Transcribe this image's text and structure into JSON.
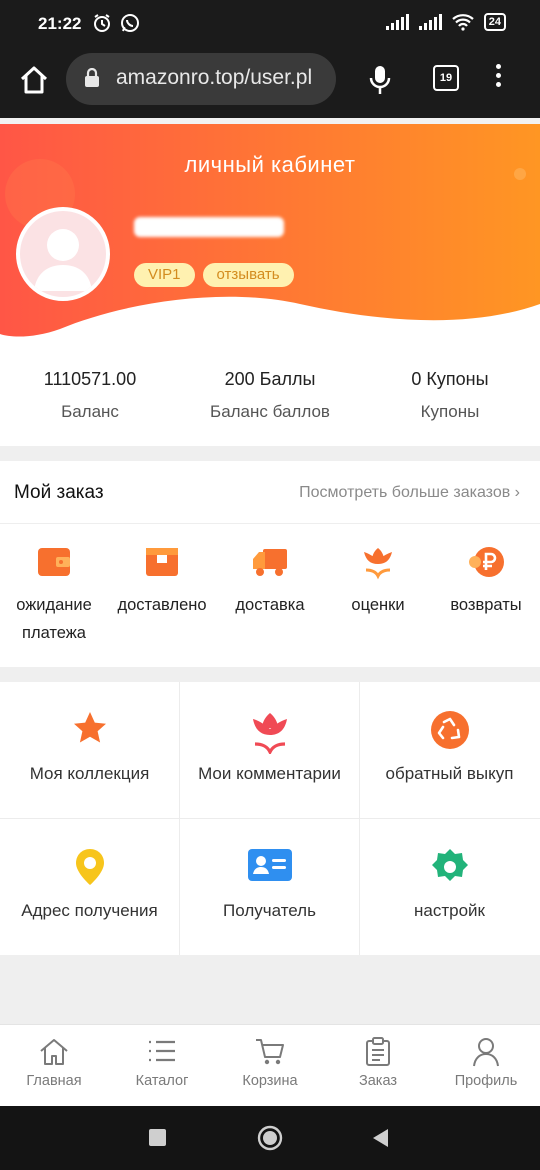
{
  "status_bar": {
    "time": "21:22",
    "battery": "24",
    "icons": [
      "alarm-icon",
      "whatsapp-icon",
      "signal-icon",
      "signal-icon",
      "wifi-icon",
      "battery-icon"
    ]
  },
  "browser": {
    "url": "amazonro.top/user.pl",
    "tab_count": "19",
    "icons": [
      "home-icon",
      "lock-icon",
      "mic-icon",
      "tabs-icon",
      "menu-kebab-icon"
    ]
  },
  "profile": {
    "title": "личный кабинет",
    "vip_badge": "VIP1",
    "review_badge": "отзывать"
  },
  "stats": [
    {
      "value": "1110571.00",
      "label": "Баланс"
    },
    {
      "value": "200 Баллы",
      "label": "Баланс баллов"
    },
    {
      "value": "0 Купоны",
      "label": "Купоны"
    }
  ],
  "orders": {
    "title": "Мой заказ",
    "more": "Посмотреть больше заказов",
    "items": [
      {
        "label": "ожидание платежа",
        "icon": "wallet-icon"
      },
      {
        "label": "доставлено",
        "icon": "box-icon"
      },
      {
        "label": "доставка",
        "icon": "truck-icon"
      },
      {
        "label": "оценки",
        "icon": "flower-icon"
      },
      {
        "label": "возвраты",
        "icon": "ruble-icon"
      }
    ]
  },
  "services": [
    {
      "label": "Моя коллекция",
      "icon": "star-icon"
    },
    {
      "label": "Мои комментарии",
      "icon": "tulip-icon"
    },
    {
      "label": "обратный выкуп",
      "icon": "recycle-icon"
    },
    {
      "label": "Адрес получения",
      "icon": "location-pin-icon"
    },
    {
      "label": "Получатель",
      "icon": "id-card-icon"
    },
    {
      "label": "настройк",
      "icon": "gear-icon"
    }
  ],
  "nav": [
    {
      "label": "Главная",
      "icon": "home-icon"
    },
    {
      "label": "Каталог",
      "icon": "list-icon"
    },
    {
      "label": "Корзина",
      "icon": "cart-icon"
    },
    {
      "label": "Заказ",
      "icon": "clipboard-icon"
    },
    {
      "label": "Профиль",
      "icon": "user-icon"
    }
  ],
  "colors": {
    "accent": "#f96a3a",
    "gradient_start": "#ff5a4a",
    "gradient_end": "#ff9322",
    "badge_bg": "#fff1b0",
    "badge_text": "#d38c1f"
  }
}
